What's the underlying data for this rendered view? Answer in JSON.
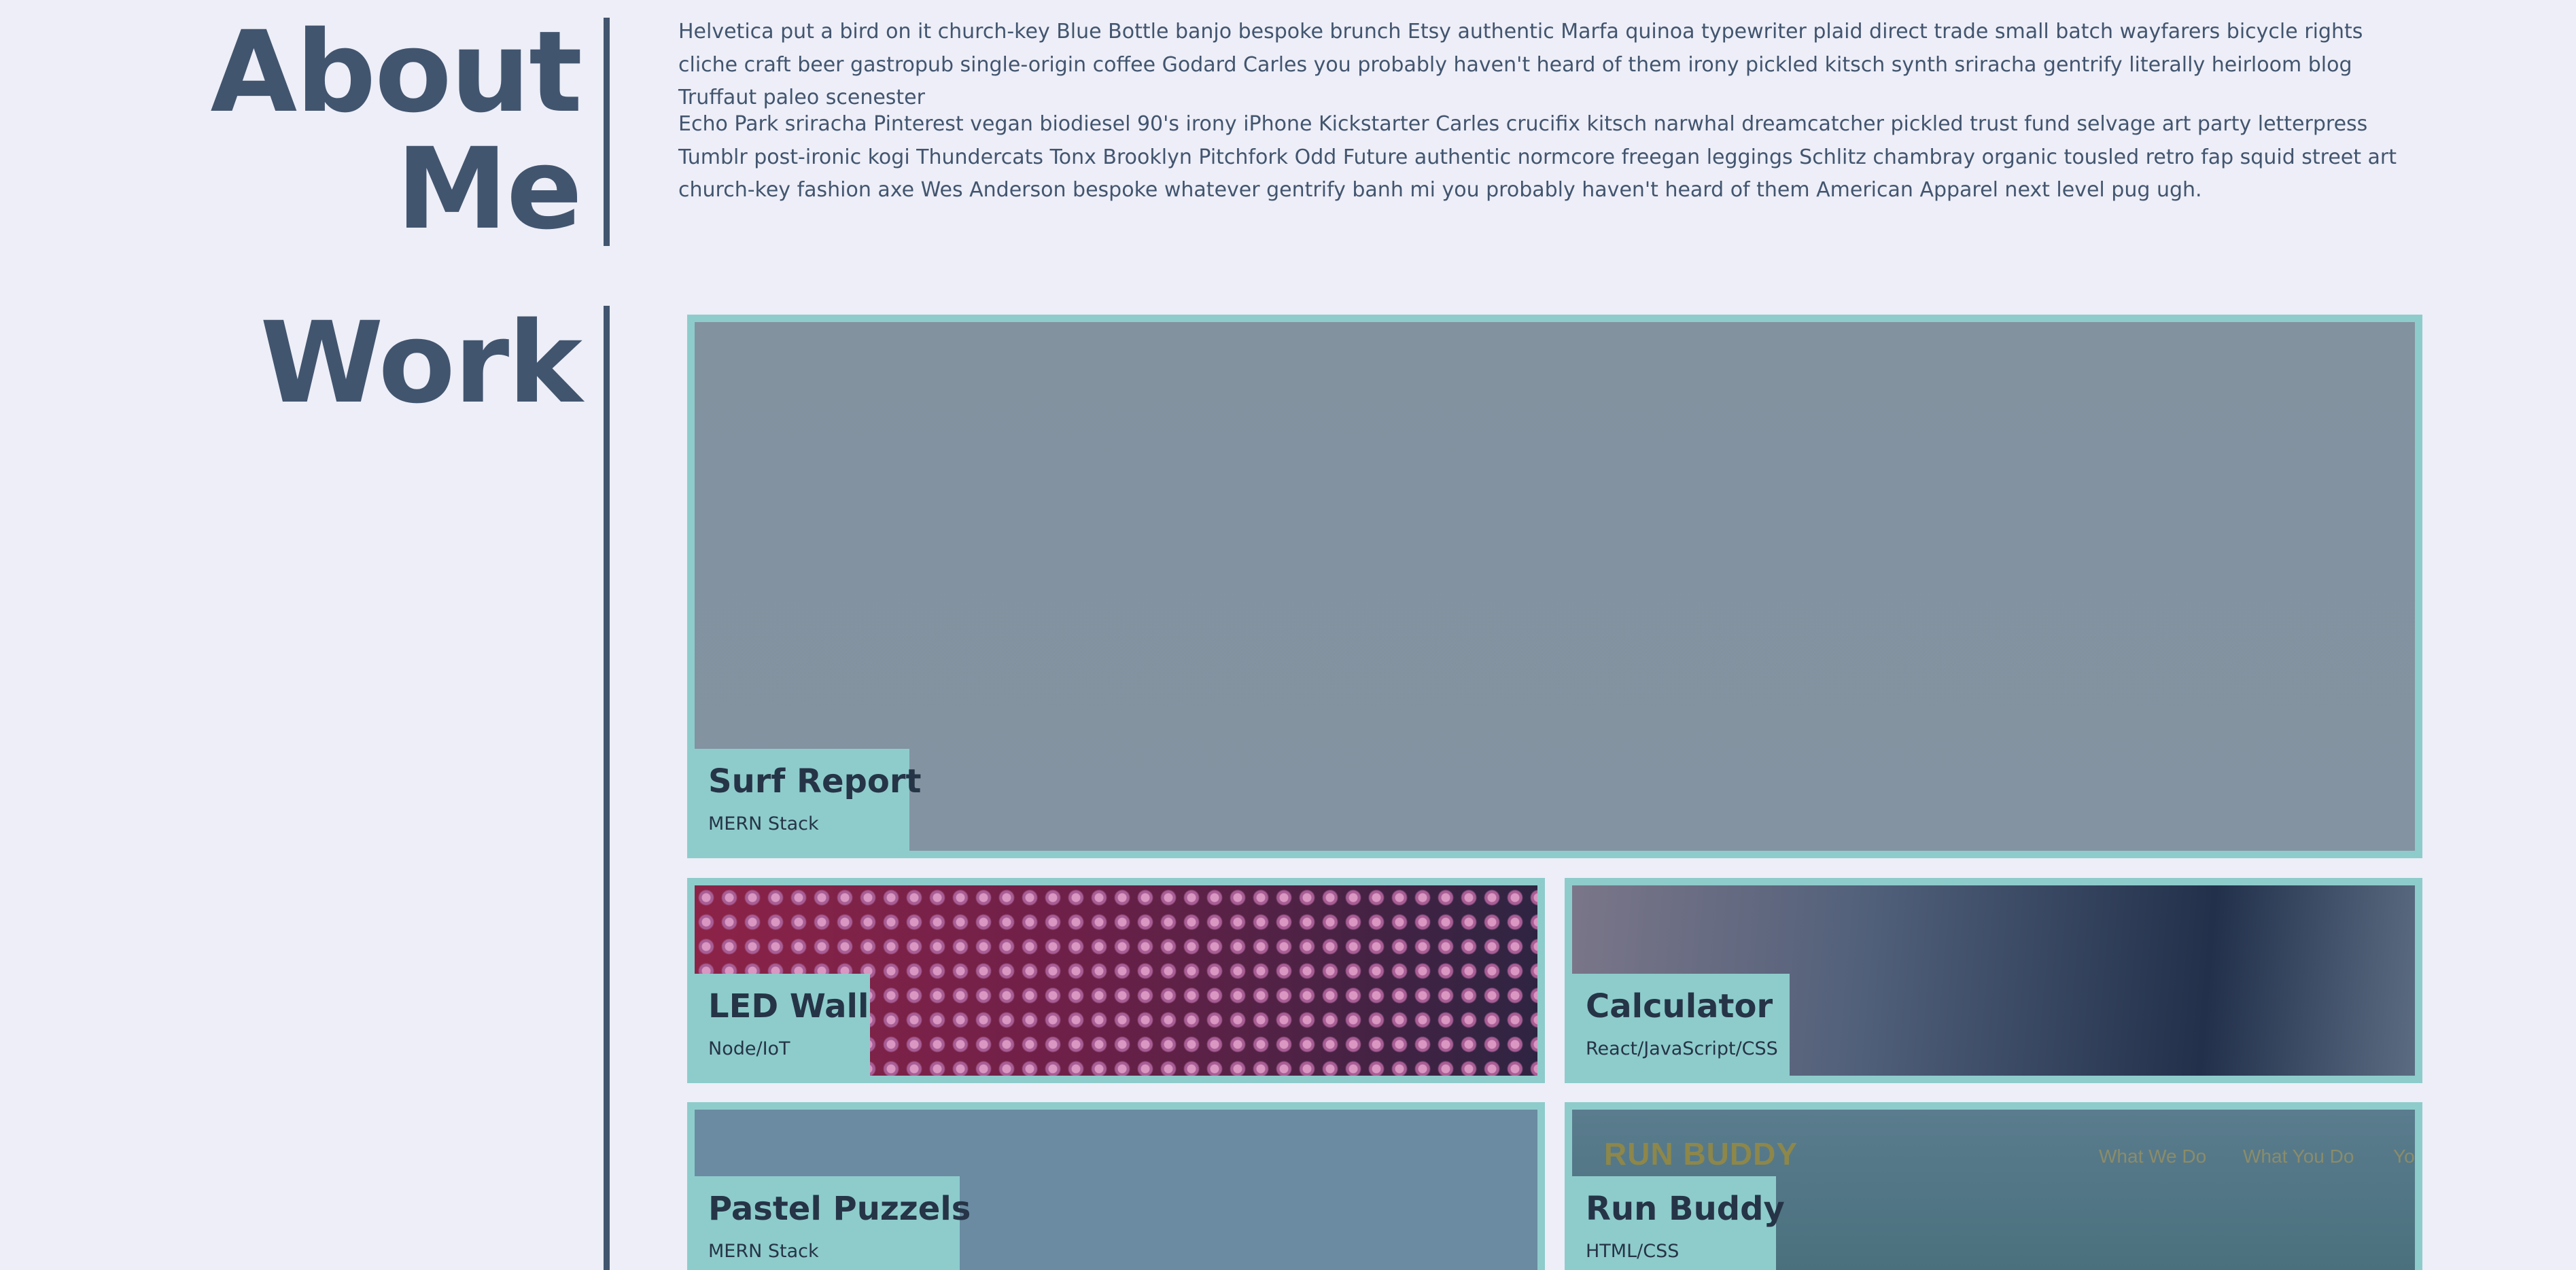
{
  "about": {
    "heading_line1": "About",
    "heading_line2": "Me",
    "paragraphs": [
      "Helvetica put a bird on it church-key Blue Bottle banjo bespoke brunch Etsy authentic Marfa quinoa typewriter plaid direct trade small batch wayfarers bicycle rights cliche craft beer gastropub single-origin coffee Godard Carles you probably haven't heard of them irony pickled kitsch synth sriracha gentrify literally heirloom blog Truffaut paleo scenester",
      "Echo Park sriracha Pinterest vegan biodiesel 90's irony iPhone Kickstarter Carles crucifix kitsch narwhal dreamcatcher pickled trust fund selvage art party letterpress Tumblr post-ironic kogi Thundercats Tonx Brooklyn Pitchfork Odd Future authentic normcore freegan leggings Schlitz chambray organic tousled retro fap squid street art church-key fashion axe Wes Anderson bespoke whatever gentrify banh mi you probably haven't heard of them American Apparel next level pug ugh."
    ]
  },
  "work": {
    "heading": "Work",
    "projects": [
      {
        "title": "Surf Report",
        "tech": "MERN Stack"
      },
      {
        "title": "LED Wall",
        "tech": "Node/IoT"
      },
      {
        "title": "Calculator",
        "tech": "React/JavaScript/CSS"
      },
      {
        "title": "Pastel Puzzels",
        "tech": "MERN Stack"
      },
      {
        "title": "Run Buddy",
        "tech": "HTML/CSS"
      }
    ],
    "run_buddy_preview": {
      "logo": "RUN BUDDY",
      "nav": [
        "What We Do",
        "What You Do",
        "Yo"
      ]
    }
  },
  "colors": {
    "background": "#edeef7",
    "heading": "#42556f",
    "accent": "#8ecccc",
    "card_text": "#263447"
  }
}
